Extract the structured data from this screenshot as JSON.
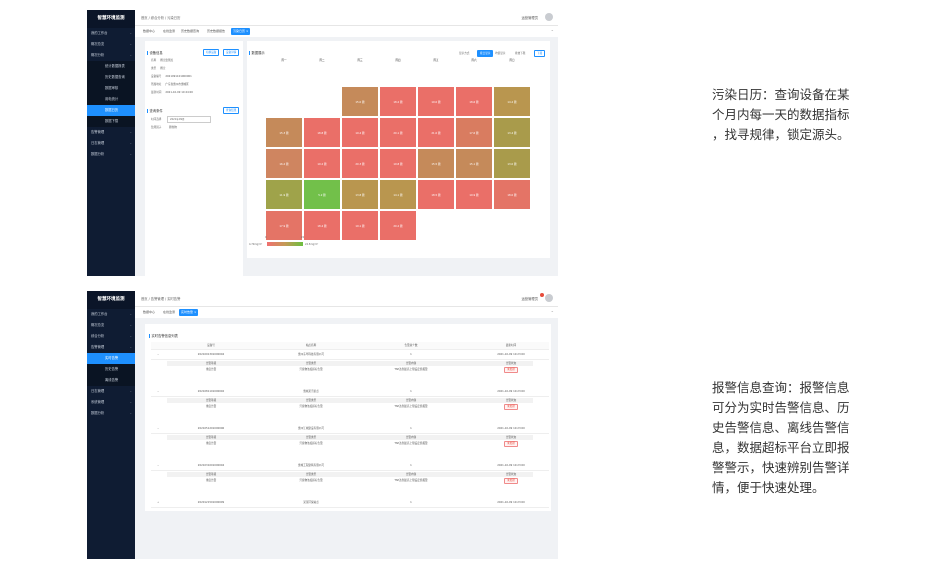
{
  "brand": "智慧环境监测",
  "sidebar1": [
    {
      "label": "我的工作台",
      "type": "item"
    },
    {
      "label": "概况总览",
      "type": "item"
    },
    {
      "label": "概况分析",
      "type": "item"
    },
    {
      "label": "统计数据报表",
      "type": "sub"
    },
    {
      "label": "历史数据查询",
      "type": "sub"
    },
    {
      "label": "数据审核",
      "type": "sub"
    },
    {
      "label": "用电统计",
      "type": "sub"
    },
    {
      "label": "数据日历",
      "type": "sub",
      "active": true
    },
    {
      "label": "数据下载",
      "type": "sub"
    },
    {
      "label": "告警管理",
      "type": "item"
    },
    {
      "label": "日志管理",
      "type": "item"
    },
    {
      "label": "数据分析",
      "type": "item"
    }
  ],
  "top1": {
    "breadcrumb": "首页 / 综合分析 / 污染日历",
    "user": "运营管理员"
  },
  "tabs1": [
    "数据中心",
    "在线监测",
    "历史数据查询",
    "历史数据报告",
    "污染日历 ×"
  ],
  "device": {
    "title": "设备信息",
    "btn_switch": "切换设备",
    "btn_detail": "设备详情",
    "fields": [
      {
        "k": "名称",
        "v": "扬尘监测点"
      },
      {
        "k": "类型",
        "v": "扬尘"
      },
      {
        "k": "设备编号",
        "v": "2021091101000001"
      },
      {
        "k": "所属地址",
        "v": "广东省惠州市惠城区"
      },
      {
        "k": "最新时间",
        "v": "2021-10-09 10:24:00"
      }
    ]
  },
  "query": {
    "title": "查询条件",
    "btn": "查询结果",
    "month_label": "时间选择",
    "month_value": "2021年09月",
    "factor_label": "监测因子",
    "factor_value": "颗粒物"
  },
  "cal": {
    "title": "数据展示",
    "mode_label": "显示方式",
    "mode_a": "按日显示",
    "mode_b": "均值显示",
    "range": "排放下限",
    "btn": "下载",
    "weekdays": [
      "周一",
      "周二",
      "周三",
      "周四",
      "周五",
      "周六",
      "周日"
    ],
    "legend_min": "4.70mg/m³",
    "legend_max": "24.5mg/m³",
    "legend_left": "0",
    "legend_right": "24"
  },
  "calendar_cells": [
    {
      "r": 0,
      "c": 2,
      "color": "#c58a5a",
      "label": "15.0 颗"
    },
    {
      "r": 0,
      "c": 3,
      "color": "#ea6f68",
      "label": "18.2 颗"
    },
    {
      "r": 0,
      "c": 4,
      "color": "#ea6f68",
      "label": "19.0 颗"
    },
    {
      "r": 0,
      "c": 5,
      "color": "#ea6f68",
      "label": "18.6 颗"
    },
    {
      "r": 0,
      "c": 6,
      "color": "#b9964f",
      "label": "14.2 颗"
    },
    {
      "r": 1,
      "c": 0,
      "color": "#c58a5a",
      "label": "15.3 颗"
    },
    {
      "r": 1,
      "c": 1,
      "color": "#ea6f68",
      "label": "18.8 颗"
    },
    {
      "r": 1,
      "c": 2,
      "color": "#ea6f68",
      "label": "19.4 颗"
    },
    {
      "r": 1,
      "c": 3,
      "color": "#ea6f68",
      "label": "20.1 颗"
    },
    {
      "r": 1,
      "c": 4,
      "color": "#ea6f68",
      "label": "21.0 颗"
    },
    {
      "r": 1,
      "c": 5,
      "color": "#d97c60",
      "label": "17.6 颗"
    },
    {
      "r": 1,
      "c": 6,
      "color": "#a99b4b",
      "label": "13.4 颗"
    },
    {
      "r": 2,
      "c": 0,
      "color": "#cf8560",
      "label": "16.2 颗"
    },
    {
      "r": 2,
      "c": 1,
      "color": "#ea6f68",
      "label": "19.2 颗"
    },
    {
      "r": 2,
      "c": 2,
      "color": "#ea6f68",
      "label": "20.3 颗"
    },
    {
      "r": 2,
      "c": 3,
      "color": "#ea6f68",
      "label": "19.8 颗"
    },
    {
      "r": 2,
      "c": 4,
      "color": "#c58a5a",
      "label": "15.5 颗"
    },
    {
      "r": 2,
      "c": 5,
      "color": "#c58a5a",
      "label": "15.1 颗"
    },
    {
      "r": 2,
      "c": 6,
      "color": "#a99b4b",
      "label": "13.0 颗"
    },
    {
      "r": 3,
      "c": 0,
      "color": "#9fa34a",
      "label": "11.9 颗"
    },
    {
      "r": 3,
      "c": 1,
      "color": "#72c04a",
      "label": "5.2 颗"
    },
    {
      "r": 3,
      "c": 2,
      "color": "#b9964f",
      "label": "13.8 颗"
    },
    {
      "r": 3,
      "c": 3,
      "color": "#b9964f",
      "label": "14.1 颗"
    },
    {
      "r": 3,
      "c": 4,
      "color": "#ea6f68",
      "label": "18.5 颗"
    },
    {
      "r": 3,
      "c": 5,
      "color": "#ea6f68",
      "label": "19.9 颗"
    },
    {
      "r": 3,
      "c": 6,
      "color": "#e47466",
      "label": "18.0 颗"
    },
    {
      "r": 4,
      "c": 0,
      "color": "#e47466",
      "label": "17.9 颗"
    },
    {
      "r": 4,
      "c": 1,
      "color": "#ea6f68",
      "label": "18.4 颗"
    },
    {
      "r": 4,
      "c": 2,
      "color": "#ea6f68",
      "label": "19.1 颗"
    },
    {
      "r": 4,
      "c": 3,
      "color": "#ea6f68",
      "label": "20.2 颗"
    }
  ],
  "sidebar2": [
    {
      "label": "我的工作台",
      "type": "item"
    },
    {
      "label": "概况总览",
      "type": "item"
    },
    {
      "label": "综合分析",
      "type": "item"
    },
    {
      "label": "告警管理",
      "type": "item"
    },
    {
      "label": "实时告警",
      "type": "sub",
      "active": true
    },
    {
      "label": "历史告警",
      "type": "sub"
    },
    {
      "label": "离线告警",
      "type": "sub"
    },
    {
      "label": "日志管理",
      "type": "item"
    },
    {
      "label": "系统管理",
      "type": "item"
    },
    {
      "label": "数据分析",
      "type": "item"
    }
  ],
  "top2": {
    "breadcrumb": "首页 / 告警管理 / 实时告警",
    "user": "运营管理员"
  },
  "tabs2": [
    "数据中心",
    "在线监测",
    "实时告警 ×"
  ],
  "alarm": {
    "title": "实时告警信息列表",
    "headers": [
      "设备号",
      "站点名称",
      "告警总个数",
      "最新时间"
    ],
    "sub_headers": [
      "告警等级",
      "告警类型",
      "告警内容",
      "告警状态"
    ],
    "rows": [
      {
        "id": "2021091301000004",
        "site": "惠州东华科技有限公司",
        "count": "1",
        "time": "2021-10-09 10:23:00",
        "sub": [
          "重度告警",
          "污染物浓度超标告警",
          "TSP达到最高上限设定值报警",
          "未处理"
        ]
      },
      {
        "id": "2021081101000002",
        "site": "惠城某污染点",
        "count": "1",
        "time": "2021-10-09 10:23:00",
        "sub": [
          "重度告警",
          "污染物浓度超标告警",
          "TSP达到最高上限设定值报警",
          "未处理"
        ]
      },
      {
        "id": "2021051201000006",
        "site": "惠州江城建设有限公司",
        "count": "1",
        "time": "2021-10-09 10:23:00",
        "sub": [
          "重度告警",
          "污染物浓度超标告警",
          "TSP达到最高上限设定值报警",
          "未处理"
        ]
      },
      {
        "id": "2021031001000004",
        "site": "惠城工程建筑有限公司",
        "count": "1",
        "time": "2021-10-09 10:23:00",
        "sub": [
          "重度告警",
          "污染物浓度超标告警",
          "TSP达到最高上限设定值报警",
          "未处理"
        ]
      },
      {
        "id": "2020121501000009",
        "site": "某某环保站点",
        "count": "1",
        "time": "2021-10-09 10:23:00",
        "sub": null
      }
    ]
  },
  "caption1": "污染日历：查询设备在某\n个月内每一天的数据指标\n，找寻规律，锁定源头。",
  "caption2": "报警信息查询：报警信息\n可分为实时告警信息、历\n史告警信息、离线告警信\n息，数据超标平台立即报\n警警示，快速辨别告警详\n情，便于快速处理。"
}
